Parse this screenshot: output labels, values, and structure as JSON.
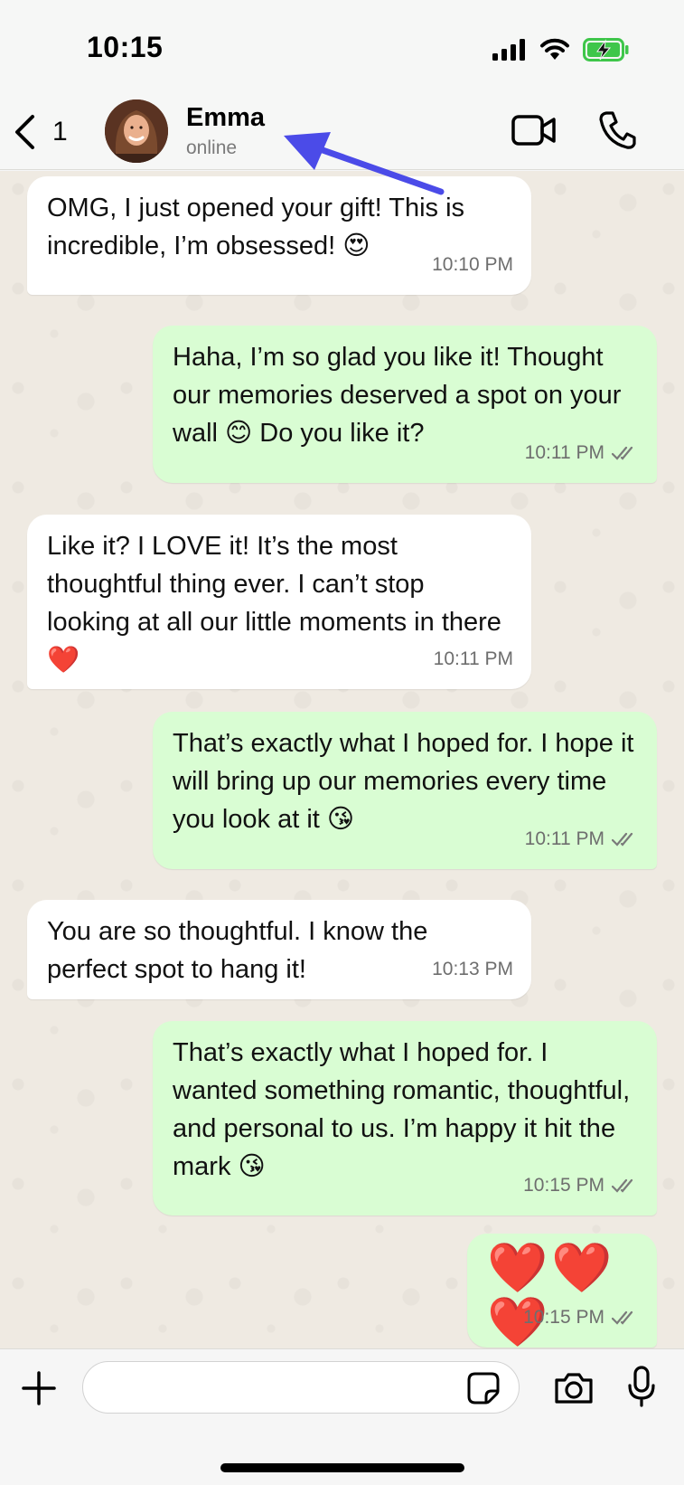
{
  "status_bar": {
    "time": "10:15"
  },
  "header": {
    "back_count": "1",
    "contact_name": "Emma",
    "contact_status": "online"
  },
  "messages": [
    {
      "direction": "in",
      "text": "OMG, I just opened your gift! This is incredible, I’m obsessed! 😍",
      "time": "10:10 PM"
    },
    {
      "direction": "out",
      "text": "Haha, I’m so glad you like it! Thought our memories deserved a spot on your wall 😊 Do you like it?",
      "time": "10:11 PM",
      "status": "read"
    },
    {
      "direction": "in",
      "text": "Like it? I LOVE it! It’s the most thoughtful thing ever. I can’t stop looking at all our little moments in there ❤️",
      "time": "10:11 PM"
    },
    {
      "direction": "out",
      "text": "That’s exactly what I hoped for. I hope it will bring up our memories every time you look at it 😘",
      "time": "10:11 PM",
      "status": "read"
    },
    {
      "direction": "in",
      "text": "You are so thoughtful. I know the perfect spot to hang it!",
      "time": "10:13 PM"
    },
    {
      "direction": "out",
      "text": "That’s exactly what I hoped for. I wanted something romantic, thoughtful, and personal to us. I’m happy it hit the mark 😘",
      "time": "10:15 PM",
      "status": "read"
    },
    {
      "direction": "out",
      "text": "❤️❤️❤️",
      "time": "10:15 PM",
      "status": "read"
    }
  ],
  "composer": {
    "input_value": "",
    "placeholder": ""
  },
  "colors": {
    "incoming_bubble": "#ffffff",
    "outgoing_bubble": "#d9fdd3",
    "wallpaper": "#efeae2",
    "annotation_arrow": "#4b4be8",
    "battery": "#3ec64a"
  },
  "icons": {
    "back": "chevron-left-icon",
    "video": "video-camera-icon",
    "call": "phone-icon",
    "plus": "plus-icon",
    "sticker": "sticker-icon",
    "camera": "camera-icon",
    "mic": "microphone-icon",
    "read_receipt": "double-check-icon"
  }
}
